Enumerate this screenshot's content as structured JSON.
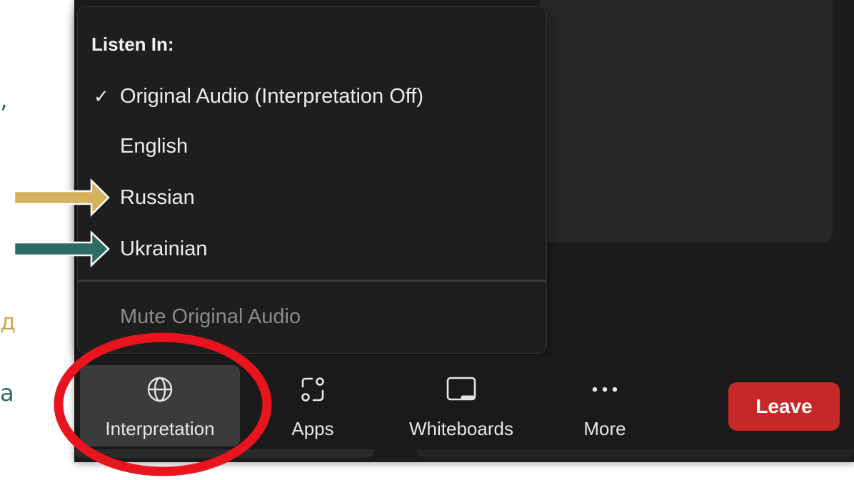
{
  "background_glyphs": [
    ",",
    "д",
    "a"
  ],
  "menu": {
    "title": "Listen In:",
    "check_glyph": "✓",
    "items": [
      {
        "label": "Original Audio (Interpretation Off)",
        "checked": true
      },
      {
        "label": "English",
        "checked": false
      },
      {
        "label": "Russian",
        "checked": false
      },
      {
        "label": "Ukrainian",
        "checked": false
      }
    ],
    "mute_label": "Mute Original Audio"
  },
  "toolbar": {
    "interpretation_label": "Interpretation",
    "apps_label": "Apps",
    "whiteboards_label": "Whiteboards",
    "more_label": "More",
    "leave_label": "Leave"
  },
  "icons": {
    "interpretation": "globe-icon",
    "apps": "apps-icon",
    "whiteboards": "whiteboard-icon",
    "more": "more-dots-icon",
    "check": "check-icon"
  },
  "annotations": {
    "russian_arrow_color": "#d4b25f",
    "ukrainian_arrow_color": "#2e6b66",
    "highlight_circle_color": "#e8141e"
  },
  "colors": {
    "leave_button": "#c62828",
    "active_button": "#3b3b3b",
    "window_background": "#1c1c1c"
  }
}
